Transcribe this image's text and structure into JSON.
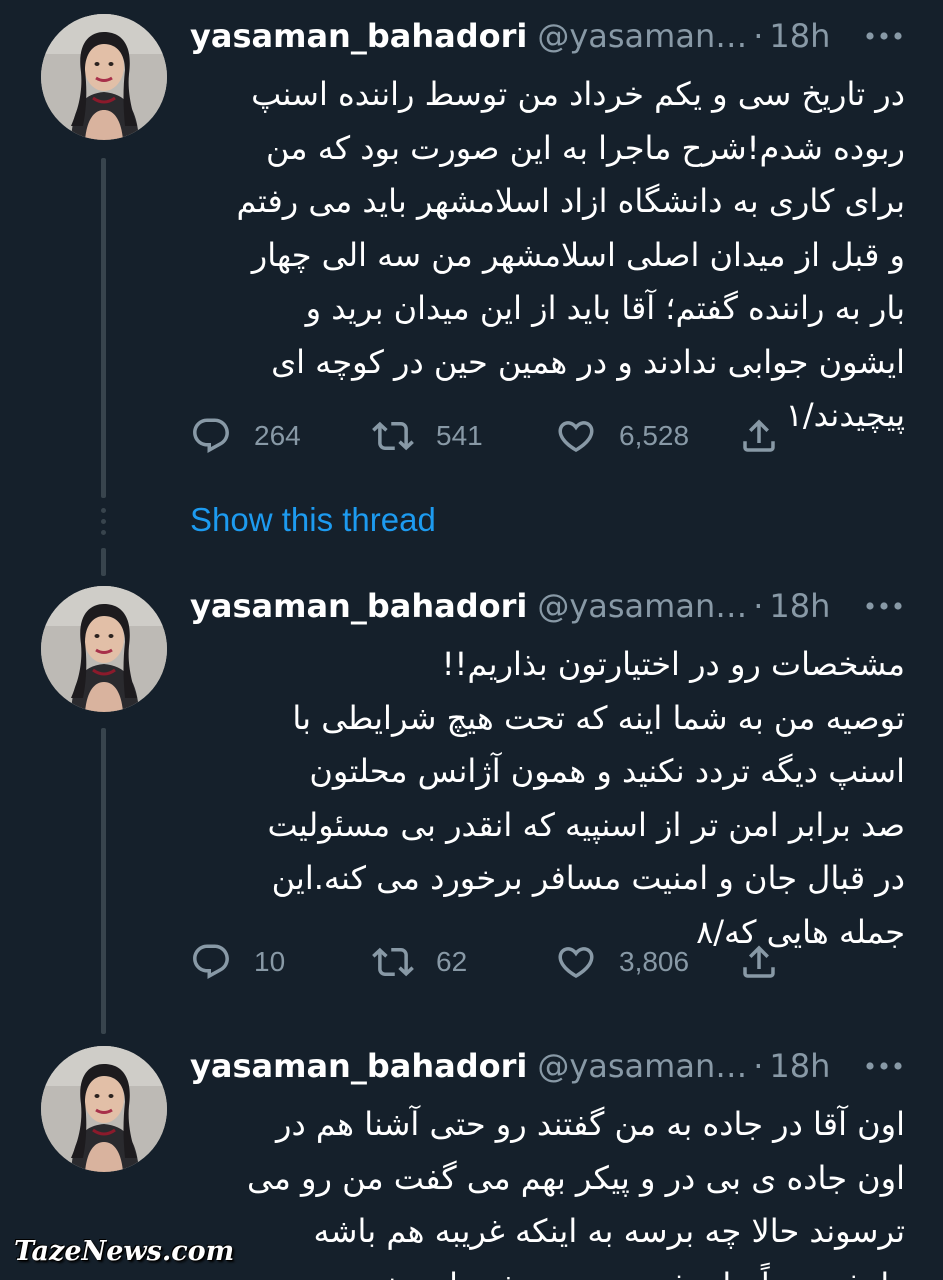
{
  "tweets": [
    {
      "author_name": "yasaman_bahadori",
      "handle": "@yasaman…",
      "separator": "·",
      "time": "18h",
      "more_icon": "more-horizontal-icon",
      "lines": [
        "در تاریخ سی و یکم خرداد من توسط راننده اسنپ",
        "ربوده شدم!شرح ماجرا به این صورت بود که من",
        "برای کاری به دانشگاه ازاد اسلامشهر باید می رفتم",
        "و قبل از میدان اصلی اسلامشهر من سه الی چهار",
        "بار به راننده گفتم؛ آقا باید از این میدان برید و",
        "ایشون جوابی ندادند و در همین حین در کوچه ای",
        "پیچیدند/۱"
      ],
      "replies": "264",
      "retweets": "541",
      "likes": "6,528"
    },
    {
      "author_name": "yasaman_bahadori",
      "handle": "@yasaman…",
      "separator": "·",
      "time": "18h",
      "more_icon": "more-horizontal-icon",
      "lines": [
        "مشخصات رو در اختیارتون بذاریم!!",
        "توصیه من به شما اینه که تحت هیچ شرایطی با",
        "اسنپ دیگه تردد نکنید و همون آژانس محلتون",
        "صد برابر امن تر از اسنپیه که انقدر بی مسئولیت",
        "در قبال جان و امنیت مسافر برخورد می کنه.این",
        "جمله هایی که/۸"
      ],
      "replies": "10",
      "retweets": "62",
      "likes": "3,806"
    },
    {
      "author_name": "yasaman_bahadori",
      "handle": "@yasaman…",
      "separator": "·",
      "time": "18h",
      "more_icon": "more-horizontal-icon",
      "lines": [
        "اون آقا در جاده به من گفتند رو حتی آشنا هم در",
        "اون جاده ی بی در و پیکر بهم می گفت من رو می",
        "ترسوند حالا چه برسه به اینکه غریبه هم باشه",
        "طرف.حتماً نباید فرد دزدیده بشه تا به خودتون"
      ]
    }
  ],
  "show_thread_label": "Show this thread",
  "watermark": "TazeNews.com",
  "icons": {
    "reply": "reply-icon",
    "retweet": "retweet-icon",
    "like": "heart-icon",
    "share": "share-icon"
  },
  "colors": {
    "background": "#15202b",
    "secondary_text": "#8899a6",
    "link": "#1d9bf0",
    "thread_line": "#38444d"
  }
}
